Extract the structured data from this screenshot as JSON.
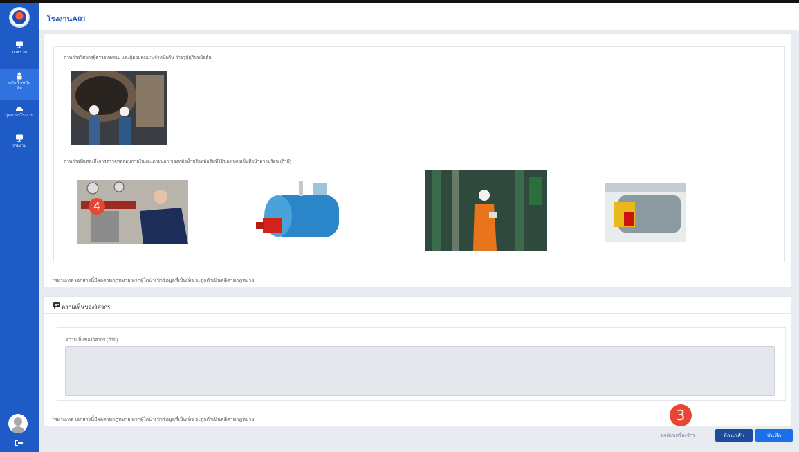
{
  "header": {
    "title": "โรงงานA01"
  },
  "sidebar": {
    "items": [
      {
        "label": "ภาพรวม",
        "icon": "monitor-icon"
      },
      {
        "label": "หม้อน้ำ/หม้อต้ม",
        "icon": "boiler-icon"
      },
      {
        "label": "บุคลากรโรงงาน",
        "icon": "worker-icon"
      },
      {
        "label": "รายงาน",
        "icon": "report-icon"
      }
    ]
  },
  "main": {
    "section1_label": "ภาพถ่ายวิศวกรผู้ตรวจทดสอบ และผู้ควบคุมประจำหม้อต้ม ถ่ายรูปคู่กับหม้อต้ม",
    "section2_label": "ภาพถ่ายที่แสดงถึงการตรวจทดสอบภายในและภายนอก ของหม้อน้ำหรือหม้อต้มที่ใช้ของเหลวเป็นสื่อนำความร้อน (ถ้ามี)",
    "note": "*หมายเหตุ เอกสารนี้มีผลตามกฎหมาย หากผู้ใดนำเข้าข้อมูลที่เป็นเท็จ จะถูกดำเนินคดีตามกฎหมาย"
  },
  "comment": {
    "section_title": "ความเห็นของวิศวกร",
    "field_label": "ความเห็นของวิศวกร (ถ้ามี)",
    "field_value": "",
    "note": "*หมายเหตุ เอกสารนี้มีผลตามกฎหมาย หากผู้ใดนำเข้าข้อมูลที่เป็นเท็จ จะถูกดำเนินคดีตามกฎหมาย"
  },
  "footer": {
    "cancel_label": "ยกเลิกเครื่องจักร",
    "back_label": "ย้อนกลับ",
    "save_label": "บันทึก"
  },
  "annotations": {
    "badge_photo": "4",
    "badge_footer": "3"
  },
  "colors": {
    "sidebar": "#1f5bc6",
    "primary": "#1b6fe8",
    "badge": "#e74634"
  }
}
